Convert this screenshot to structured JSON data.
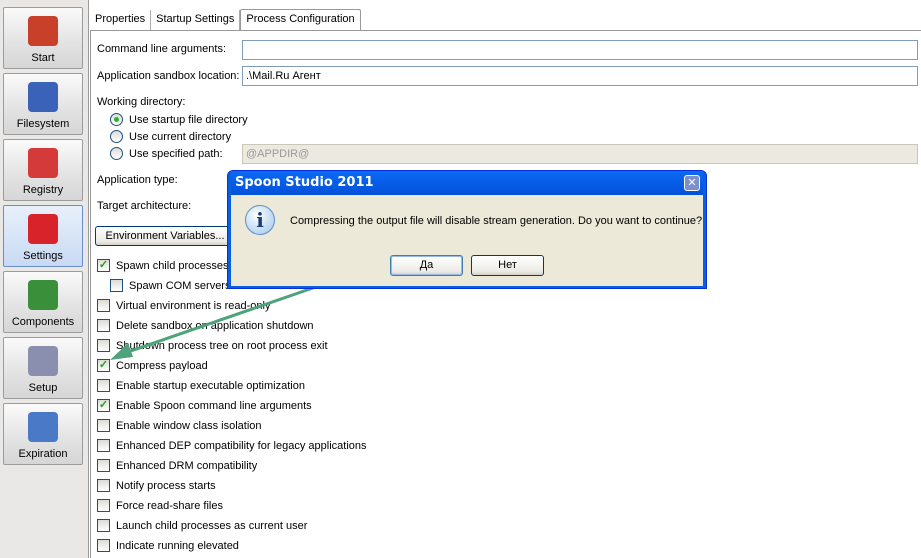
{
  "sidebar": {
    "items": [
      {
        "label": "Start",
        "icon": "house-icon",
        "color": "#c8402a"
      },
      {
        "label": "Filesystem",
        "icon": "drive-icon",
        "color": "#3a62b8"
      },
      {
        "label": "Registry",
        "icon": "registry-blocks-icon",
        "color": "#d43a3a"
      },
      {
        "label": "Settings",
        "icon": "toolbox-icon",
        "color": "#d8232a"
      },
      {
        "label": "Components",
        "icon": "shapes-icon",
        "color": "#3a8f3a"
      },
      {
        "label": "Setup",
        "icon": "setup-box-icon",
        "color": "#8a8fb0"
      },
      {
        "label": "Expiration",
        "icon": "alarm-clock-icon",
        "color": "#4a79c8"
      }
    ],
    "selected": "Settings"
  },
  "tabs": [
    "Properties",
    "Startup Settings",
    "Process Configuration"
  ],
  "form": {
    "cmd_label": "Command line arguments:",
    "cmd_value": "",
    "sandbox_label": "Application sandbox location:",
    "sandbox_value": ".\\Mail.Ru Агент",
    "workdir_label": "Working directory:",
    "radios": [
      "Use startup file directory",
      "Use current directory",
      "Use specified path:"
    ],
    "specified_path": "@APPDIR@",
    "apptype_label": "Application type:",
    "arch_label": "Target architecture:",
    "env_button": "Environment Variables..."
  },
  "checkboxes": [
    {
      "label": "Spawn child processes",
      "checked": true
    },
    {
      "label": "Spawn COM servers",
      "checked": false
    },
    {
      "label": "Virtual environment is read-only",
      "checked": false
    },
    {
      "label": "Delete sandbox on application shutdown",
      "checked": false
    },
    {
      "label": "Shutdown process tree on root process exit",
      "checked": false
    },
    {
      "label": "Compress payload",
      "checked": true
    },
    {
      "label": "Enable startup executable optimization",
      "checked": false
    },
    {
      "label": "Enable Spoon command line arguments",
      "checked": true
    },
    {
      "label": "Enable window class isolation",
      "checked": false
    },
    {
      "label": "Enhanced DEP compatibility for legacy applications",
      "checked": false
    },
    {
      "label": "Enhanced DRM compatibility",
      "checked": false
    },
    {
      "label": "Notify process starts",
      "checked": false
    },
    {
      "label": "Force read-share files",
      "checked": false
    },
    {
      "label": "Launch child processes as current user",
      "checked": false
    },
    {
      "label": "Indicate running elevated",
      "checked": false
    }
  ],
  "dialog": {
    "title": "Spoon Studio 2011",
    "message": "Compressing the output file will disable stream generation. Do you want to continue?",
    "yes": "Да",
    "no": "Нет",
    "close": "✕",
    "info_glyph": "i"
  },
  "annotation_color": "#4fa37a"
}
